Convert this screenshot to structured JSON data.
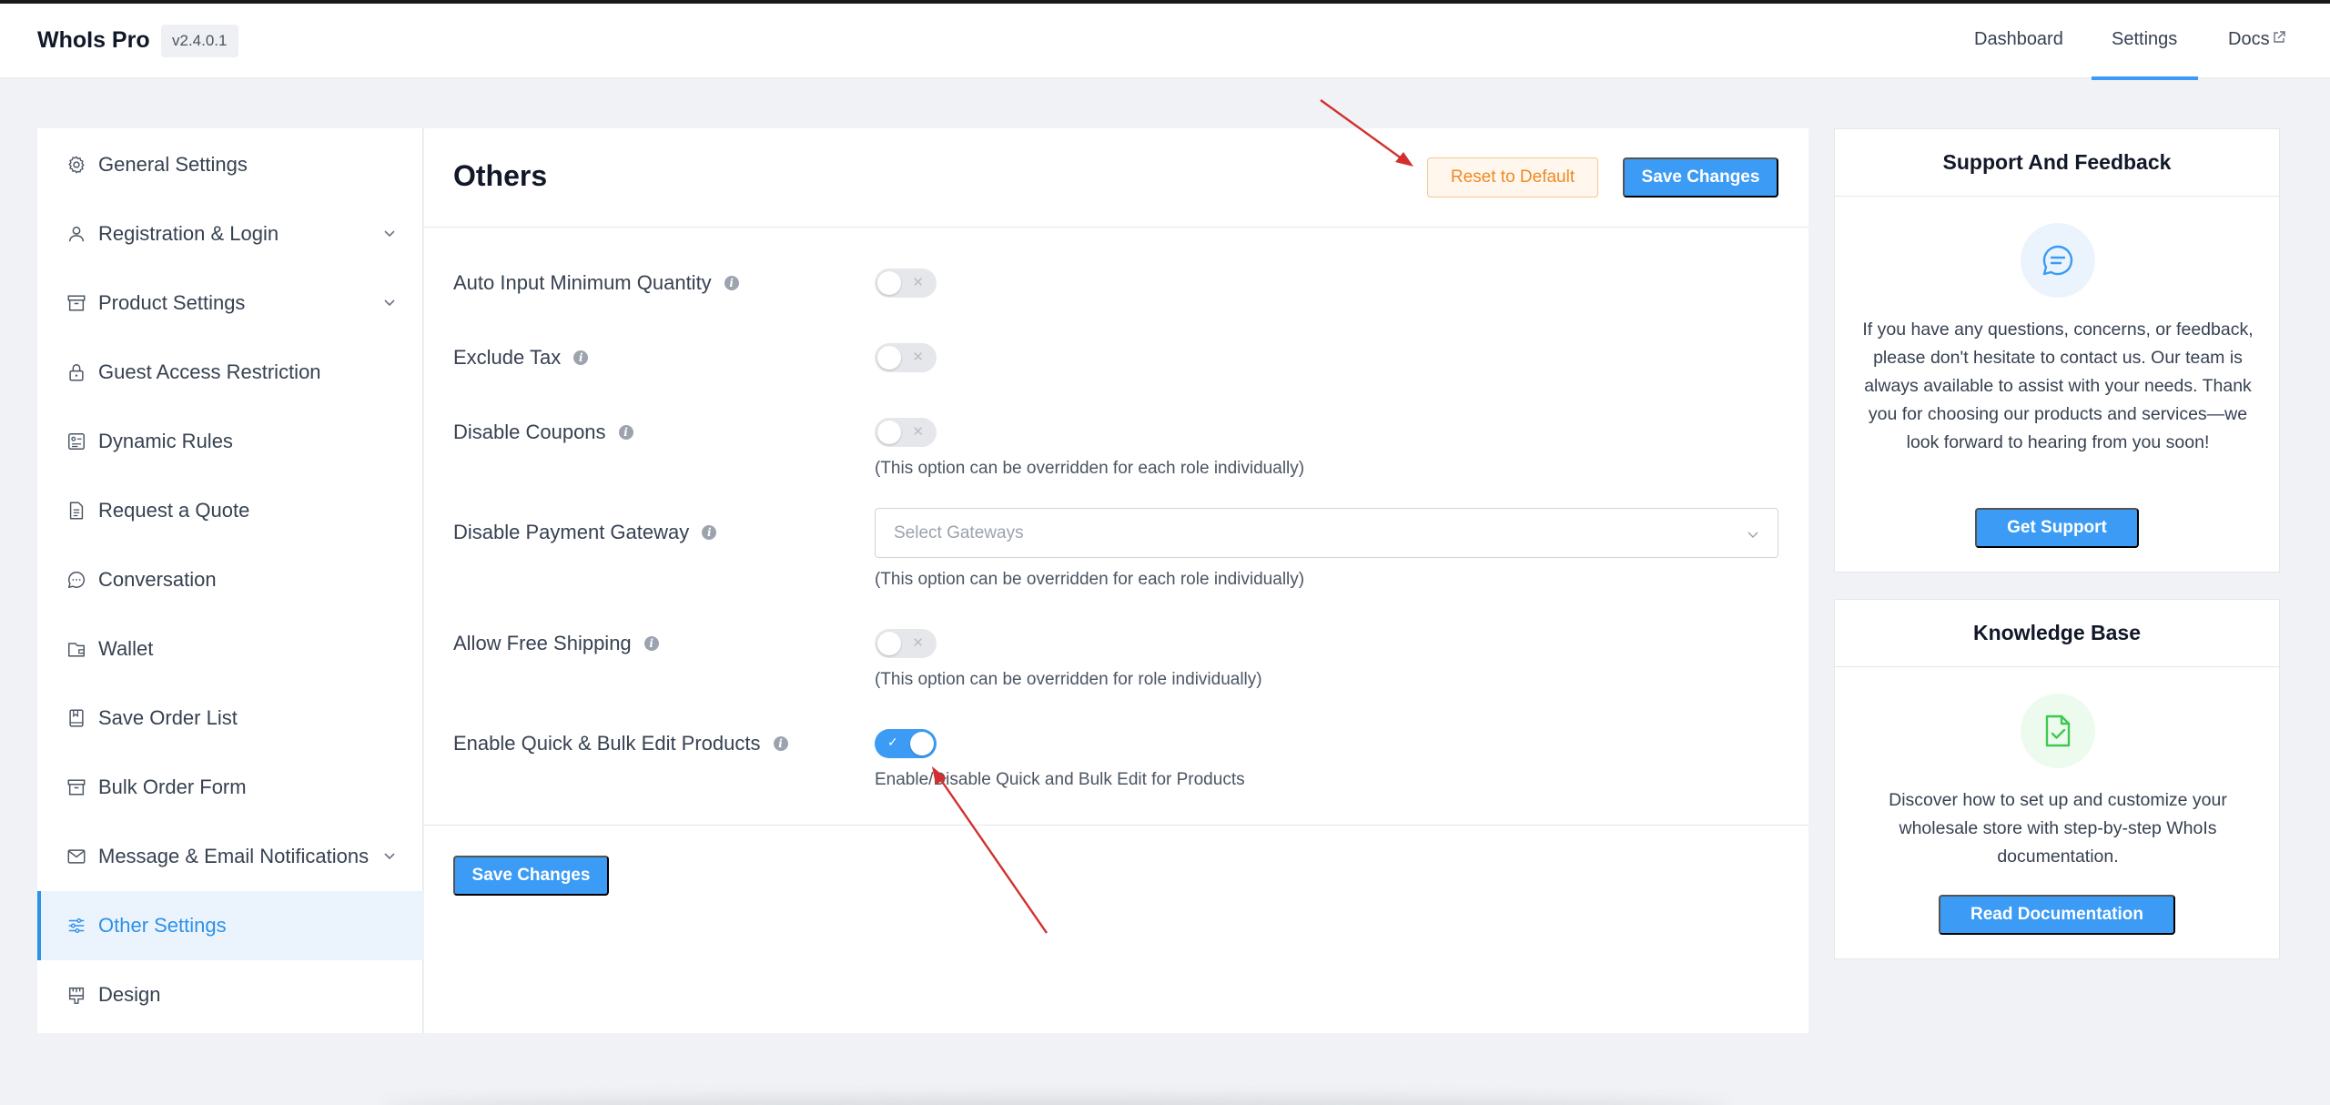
{
  "app": {
    "name": "WhoIs Pro",
    "version": "v2.4.0.1"
  },
  "nav": {
    "dashboard": "Dashboard",
    "settings": "Settings",
    "docs": "Docs"
  },
  "sidebar": {
    "items": [
      {
        "label": "General Settings",
        "icon": "gear-icon"
      },
      {
        "label": "Registration & Login",
        "icon": "user-icon"
      },
      {
        "label": "Product Settings",
        "icon": "archive-icon"
      },
      {
        "label": "Guest Access Restriction",
        "icon": "lock-icon"
      },
      {
        "label": "Dynamic Rules",
        "icon": "rules-icon"
      },
      {
        "label": "Request a Quote",
        "icon": "document-icon"
      },
      {
        "label": "Conversation",
        "icon": "chat-icon"
      },
      {
        "label": "Wallet",
        "icon": "wallet-icon"
      },
      {
        "label": "Save Order List",
        "icon": "bookmark-icon"
      },
      {
        "label": "Bulk Order Form",
        "icon": "archive-icon"
      },
      {
        "label": "Message & Email Notifications",
        "icon": "mail-icon"
      },
      {
        "label": "Other Settings",
        "icon": "sliders-icon",
        "active": true
      },
      {
        "label": "Design",
        "icon": "design-icon"
      }
    ]
  },
  "main": {
    "title": "Others",
    "reset_label": "Reset to Default",
    "save_label": "Save Changes",
    "settings": {
      "auto_input": {
        "label": "Auto Input Minimum Quantity",
        "enabled": false
      },
      "exclude_tax": {
        "label": "Exclude Tax",
        "enabled": false
      },
      "disable_coupons": {
        "label": "Disable Coupons",
        "enabled": false,
        "hint": "(This option can be overridden for each role individually)"
      },
      "disable_gateway": {
        "label": "Disable Payment Gateway",
        "placeholder": "Select Gateways",
        "hint": "(This option can be overridden for each role individually)"
      },
      "free_shipping": {
        "label": "Allow Free Shipping",
        "enabled": false,
        "hint": "(This option can be overridden for role individually)"
      },
      "quick_bulk": {
        "label": "Enable Quick & Bulk Edit Products",
        "enabled": true,
        "hint": "Enable/Disable Quick and Bulk Edit for Products"
      }
    }
  },
  "support": {
    "title": "Support And Feedback",
    "text": "If you have any questions, concerns, or feedback, please don't hesitate to contact us. Our team is always available to assist with your needs. Thank you for choosing our products and services—we look forward to hearing from you soon!",
    "button": "Get Support"
  },
  "knowledge": {
    "title": "Knowledge Base",
    "text": "Discover how to set up and customize your wholesale store with step-by-step WhoIs documentation.",
    "button": "Read Documentation"
  },
  "colors": {
    "accent": "#3b9bf5",
    "reset": "#f08a24",
    "annotation_arrow": "#d32f2f"
  }
}
